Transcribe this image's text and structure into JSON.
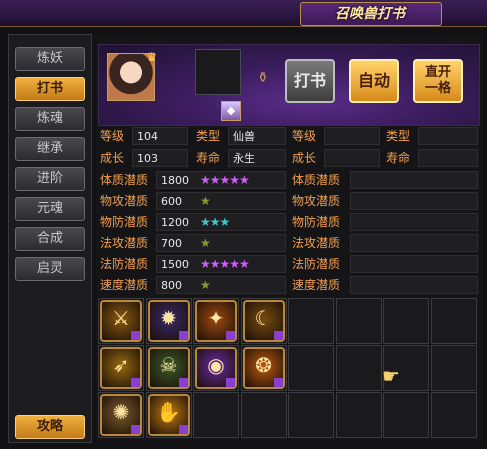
{
  "title": "召唤兽打书",
  "nav": {
    "items": [
      {
        "label": "炼妖",
        "active": false
      },
      {
        "label": "打书",
        "active": true
      },
      {
        "label": "炼魂",
        "active": false
      },
      {
        "label": "继承",
        "active": false
      },
      {
        "label": "进阶",
        "active": false
      },
      {
        "label": "元魂",
        "active": false
      },
      {
        "label": "合成",
        "active": false
      },
      {
        "label": "启灵",
        "active": false
      }
    ],
    "guide": "攻略"
  },
  "actions": {
    "study": "打书",
    "auto": "自动",
    "straight_line1": "直开",
    "straight_line2": "一格"
  },
  "left_info": [
    {
      "label1": "等级",
      "value1": "104",
      "label2": "类型",
      "value2": "仙兽"
    },
    {
      "label1": "成长",
      "value1": "103",
      "label2": "寿命",
      "value2": "永生"
    }
  ],
  "right_info": [
    {
      "label1": "等级",
      "value1": "",
      "label2": "类型",
      "value2": ""
    },
    {
      "label1": "成长",
      "value1": "",
      "label2": "寿命",
      "value2": ""
    }
  ],
  "aptitudes": [
    {
      "label": "体质潜质",
      "value": "1800",
      "stars": 5,
      "color": "#d15cff"
    },
    {
      "label": "物攻潜质",
      "value": "600",
      "stars": 1,
      "color": "#8c9a2c"
    },
    {
      "label": "物防潜质",
      "value": "1200",
      "stars": 3,
      "color": "#3fc8c8"
    },
    {
      "label": "法攻潜质",
      "value": "700",
      "stars": 1,
      "color": "#8c9a2c"
    },
    {
      "label": "法防潜质",
      "value": "1500",
      "stars": 5,
      "color": "#d15cff"
    },
    {
      "label": "速度潜质",
      "value": "800",
      "stars": 1,
      "color": "#8c9a2c"
    }
  ],
  "right_aptitudes": [
    "体质潜质",
    "物攻潜质",
    "物防潜质",
    "法攻潜质",
    "法防潜质",
    "速度潜质"
  ],
  "skills": [
    {
      "name": "skill-1",
      "glyph": "⚔",
      "color": "#8a5a10"
    },
    {
      "name": "skill-2",
      "glyph": "✹",
      "color": "#3a2a6a"
    },
    {
      "name": "skill-3",
      "glyph": "✦",
      "color": "#a04a10"
    },
    {
      "name": "skill-4",
      "glyph": "☾",
      "color": "#7a4a10"
    },
    {
      "name": "skill-5",
      "glyph": "➶",
      "color": "#9a6a10"
    },
    {
      "name": "skill-6",
      "glyph": "☠",
      "color": "#3a5a2a"
    },
    {
      "name": "skill-7",
      "glyph": "◉",
      "color": "#6a2aa0"
    },
    {
      "name": "skill-8",
      "glyph": "❂",
      "color": "#c05a10"
    },
    {
      "name": "skill-9",
      "glyph": "✺",
      "color": "#7a5a2a"
    },
    {
      "name": "skill-10",
      "glyph": "✋",
      "color": "#c07a10"
    }
  ]
}
